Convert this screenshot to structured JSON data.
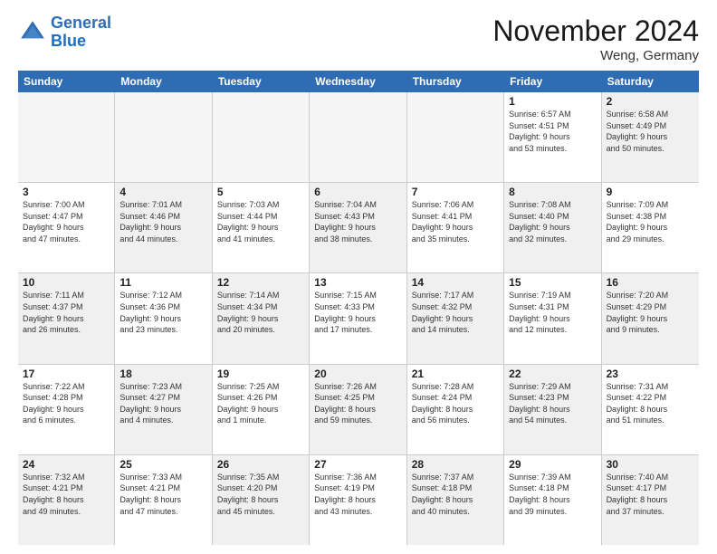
{
  "header": {
    "logo_line1": "General",
    "logo_line2": "Blue",
    "month": "November 2024",
    "location": "Weng, Germany"
  },
  "weekdays": [
    "Sunday",
    "Monday",
    "Tuesday",
    "Wednesday",
    "Thursday",
    "Friday",
    "Saturday"
  ],
  "rows": [
    [
      {
        "day": "",
        "info": "",
        "empty": true
      },
      {
        "day": "",
        "info": "",
        "empty": true
      },
      {
        "day": "",
        "info": "",
        "empty": true
      },
      {
        "day": "",
        "info": "",
        "empty": true
      },
      {
        "day": "",
        "info": "",
        "empty": true
      },
      {
        "day": "1",
        "info": "Sunrise: 6:57 AM\nSunset: 4:51 PM\nDaylight: 9 hours\nand 53 minutes.",
        "empty": false
      },
      {
        "day": "2",
        "info": "Sunrise: 6:58 AM\nSunset: 4:49 PM\nDaylight: 9 hours\nand 50 minutes.",
        "empty": false,
        "shaded": true
      }
    ],
    [
      {
        "day": "3",
        "info": "Sunrise: 7:00 AM\nSunset: 4:47 PM\nDaylight: 9 hours\nand 47 minutes.",
        "empty": false
      },
      {
        "day": "4",
        "info": "Sunrise: 7:01 AM\nSunset: 4:46 PM\nDaylight: 9 hours\nand 44 minutes.",
        "empty": false,
        "shaded": true
      },
      {
        "day": "5",
        "info": "Sunrise: 7:03 AM\nSunset: 4:44 PM\nDaylight: 9 hours\nand 41 minutes.",
        "empty": false
      },
      {
        "day": "6",
        "info": "Sunrise: 7:04 AM\nSunset: 4:43 PM\nDaylight: 9 hours\nand 38 minutes.",
        "empty": false,
        "shaded": true
      },
      {
        "day": "7",
        "info": "Sunrise: 7:06 AM\nSunset: 4:41 PM\nDaylight: 9 hours\nand 35 minutes.",
        "empty": false
      },
      {
        "day": "8",
        "info": "Sunrise: 7:08 AM\nSunset: 4:40 PM\nDaylight: 9 hours\nand 32 minutes.",
        "empty": false,
        "shaded": true
      },
      {
        "day": "9",
        "info": "Sunrise: 7:09 AM\nSunset: 4:38 PM\nDaylight: 9 hours\nand 29 minutes.",
        "empty": false
      }
    ],
    [
      {
        "day": "10",
        "info": "Sunrise: 7:11 AM\nSunset: 4:37 PM\nDaylight: 9 hours\nand 26 minutes.",
        "empty": false,
        "shaded": true
      },
      {
        "day": "11",
        "info": "Sunrise: 7:12 AM\nSunset: 4:36 PM\nDaylight: 9 hours\nand 23 minutes.",
        "empty": false
      },
      {
        "day": "12",
        "info": "Sunrise: 7:14 AM\nSunset: 4:34 PM\nDaylight: 9 hours\nand 20 minutes.",
        "empty": false,
        "shaded": true
      },
      {
        "day": "13",
        "info": "Sunrise: 7:15 AM\nSunset: 4:33 PM\nDaylight: 9 hours\nand 17 minutes.",
        "empty": false
      },
      {
        "day": "14",
        "info": "Sunrise: 7:17 AM\nSunset: 4:32 PM\nDaylight: 9 hours\nand 14 minutes.",
        "empty": false,
        "shaded": true
      },
      {
        "day": "15",
        "info": "Sunrise: 7:19 AM\nSunset: 4:31 PM\nDaylight: 9 hours\nand 12 minutes.",
        "empty": false
      },
      {
        "day": "16",
        "info": "Sunrise: 7:20 AM\nSunset: 4:29 PM\nDaylight: 9 hours\nand 9 minutes.",
        "empty": false,
        "shaded": true
      }
    ],
    [
      {
        "day": "17",
        "info": "Sunrise: 7:22 AM\nSunset: 4:28 PM\nDaylight: 9 hours\nand 6 minutes.",
        "empty": false
      },
      {
        "day": "18",
        "info": "Sunrise: 7:23 AM\nSunset: 4:27 PM\nDaylight: 9 hours\nand 4 minutes.",
        "empty": false,
        "shaded": true
      },
      {
        "day": "19",
        "info": "Sunrise: 7:25 AM\nSunset: 4:26 PM\nDaylight: 9 hours\nand 1 minute.",
        "empty": false
      },
      {
        "day": "20",
        "info": "Sunrise: 7:26 AM\nSunset: 4:25 PM\nDaylight: 8 hours\nand 59 minutes.",
        "empty": false,
        "shaded": true
      },
      {
        "day": "21",
        "info": "Sunrise: 7:28 AM\nSunset: 4:24 PM\nDaylight: 8 hours\nand 56 minutes.",
        "empty": false
      },
      {
        "day": "22",
        "info": "Sunrise: 7:29 AM\nSunset: 4:23 PM\nDaylight: 8 hours\nand 54 minutes.",
        "empty": false,
        "shaded": true
      },
      {
        "day": "23",
        "info": "Sunrise: 7:31 AM\nSunset: 4:22 PM\nDaylight: 8 hours\nand 51 minutes.",
        "empty": false
      }
    ],
    [
      {
        "day": "24",
        "info": "Sunrise: 7:32 AM\nSunset: 4:21 PM\nDaylight: 8 hours\nand 49 minutes.",
        "empty": false,
        "shaded": true
      },
      {
        "day": "25",
        "info": "Sunrise: 7:33 AM\nSunset: 4:21 PM\nDaylight: 8 hours\nand 47 minutes.",
        "empty": false
      },
      {
        "day": "26",
        "info": "Sunrise: 7:35 AM\nSunset: 4:20 PM\nDaylight: 8 hours\nand 45 minutes.",
        "empty": false,
        "shaded": true
      },
      {
        "day": "27",
        "info": "Sunrise: 7:36 AM\nSunset: 4:19 PM\nDaylight: 8 hours\nand 43 minutes.",
        "empty": false
      },
      {
        "day": "28",
        "info": "Sunrise: 7:37 AM\nSunset: 4:18 PM\nDaylight: 8 hours\nand 40 minutes.",
        "empty": false,
        "shaded": true
      },
      {
        "day": "29",
        "info": "Sunrise: 7:39 AM\nSunset: 4:18 PM\nDaylight: 8 hours\nand 39 minutes.",
        "empty": false
      },
      {
        "day": "30",
        "info": "Sunrise: 7:40 AM\nSunset: 4:17 PM\nDaylight: 8 hours\nand 37 minutes.",
        "empty": false,
        "shaded": true
      }
    ]
  ]
}
